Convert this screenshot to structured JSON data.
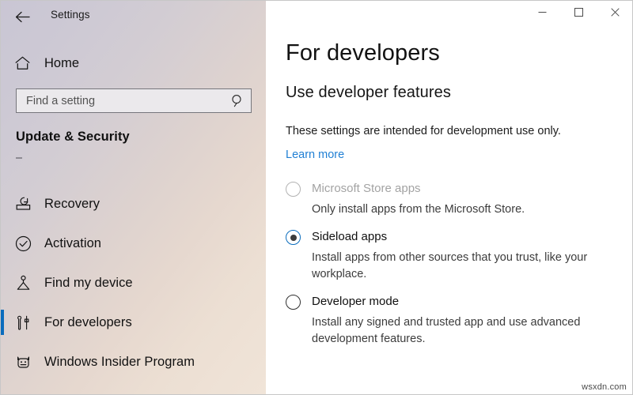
{
  "window": {
    "app_title": "Settings",
    "back_icon": "back-arrow-icon",
    "controls": {
      "minimize": "minimize-icon",
      "maximize": "maximize-icon",
      "close": "close-icon"
    }
  },
  "sidebar": {
    "home": {
      "label": "Home",
      "icon": "home-icon"
    },
    "search": {
      "value": "",
      "placeholder": "Find a setting",
      "icon": "search-icon"
    },
    "section_header": "Update & Security",
    "items": [
      {
        "label": "Recovery",
        "icon": "recovery-icon",
        "selected": false
      },
      {
        "label": "Activation",
        "icon": "check-circle-icon",
        "selected": false
      },
      {
        "label": "Find my device",
        "icon": "location-pin-icon",
        "selected": false
      },
      {
        "label": "For developers",
        "icon": "developer-tools-icon",
        "selected": true
      },
      {
        "label": "Windows Insider Program",
        "icon": "ninjacat-icon",
        "selected": false
      }
    ]
  },
  "main": {
    "page_title": "For developers",
    "subheading": "Use developer features",
    "description": "These settings are intended for development use only.",
    "learn_more": "Learn more",
    "options": [
      {
        "label": "Microsoft Store apps",
        "description": "Only install apps from the Microsoft Store.",
        "checked": false,
        "disabled": true
      },
      {
        "label": "Sideload apps",
        "description": "Install apps from other sources that you trust, like your workplace.",
        "checked": true,
        "disabled": false
      },
      {
        "label": "Developer mode",
        "description": "Install any signed and trusted app and use advanced development features.",
        "checked": false,
        "disabled": false
      }
    ]
  },
  "watermark": "wsxdn.com",
  "colors": {
    "accent_blue": "#0a6cbd",
    "link_blue": "#1f7fd4",
    "sidebar_top": "#c9c6d4",
    "sidebar_bottom": "#f0e4d8",
    "disabled_text": "#a3a3a3"
  }
}
